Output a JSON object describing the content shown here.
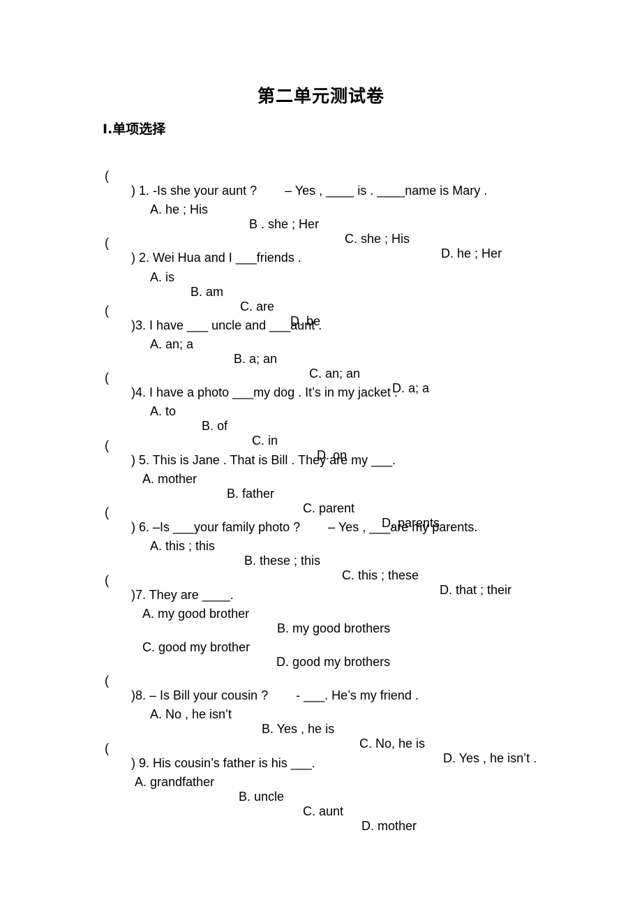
{
  "title": "第二单元测试卷",
  "section": "Ⅰ.单项选择",
  "questions": [
    {
      "paren": "(",
      "text": ") 1. -Is she your aunt ?        – Yes , ____ is . ____name is Mary .",
      "options": [
        "A. he ; His",
        "B . she ; Her",
        "C. she ; His",
        "D. he ; Her"
      ]
    },
    {
      "paren": "(",
      "text": ") 2. Wei Hua and I ___friends .",
      "options": [
        "A. is",
        "B. am",
        "C. are",
        "D. be"
      ]
    },
    {
      "paren": "(",
      "text": ")3. I have ___ uncle and ___aunt .",
      "options": [
        "A. an; a",
        "B. a; an",
        "C. an; an",
        "D. a; a"
      ]
    },
    {
      "paren": "(",
      "text": ")4. I have a photo ___my dog . It’s in my jacket .",
      "options": [
        "A. to",
        "B. of",
        "C. in",
        "D. on"
      ]
    },
    {
      "paren": "(",
      "text": ") 5. This is Jane . That is Bill . They are my ___.",
      "options": [
        "A. mother",
        "B. father",
        "C. parent",
        "D. parents"
      ]
    },
    {
      "paren": "(",
      "text": ") 6. –Is ___your family photo ?        – Yes , ___are my parents.",
      "options": [
        "A. this ; this",
        "B. these ; this",
        "C. this ; these",
        "D. that ; their"
      ]
    },
    {
      "paren": "(",
      "text": ")7. They are ____.",
      "options": [
        "A. my good brother",
        "B. my good brothers",
        "C. good my brother",
        "D. good my brothers"
      ]
    },
    {
      "paren": "(",
      "text": ")8. – Is Bill your cousin ?        - ___. He’s my friend .",
      "options": [
        "A. No , he isn’t",
        "B. Yes , he is",
        "C. No, he is",
        "D. Yes , he isn’t ."
      ]
    },
    {
      "paren": "(",
      "text": ") 9. His cousin’s father is his ___.",
      "options": [
        "A. grandfather",
        "B. uncle",
        "C. aunt",
        "D. mother"
      ]
    }
  ]
}
